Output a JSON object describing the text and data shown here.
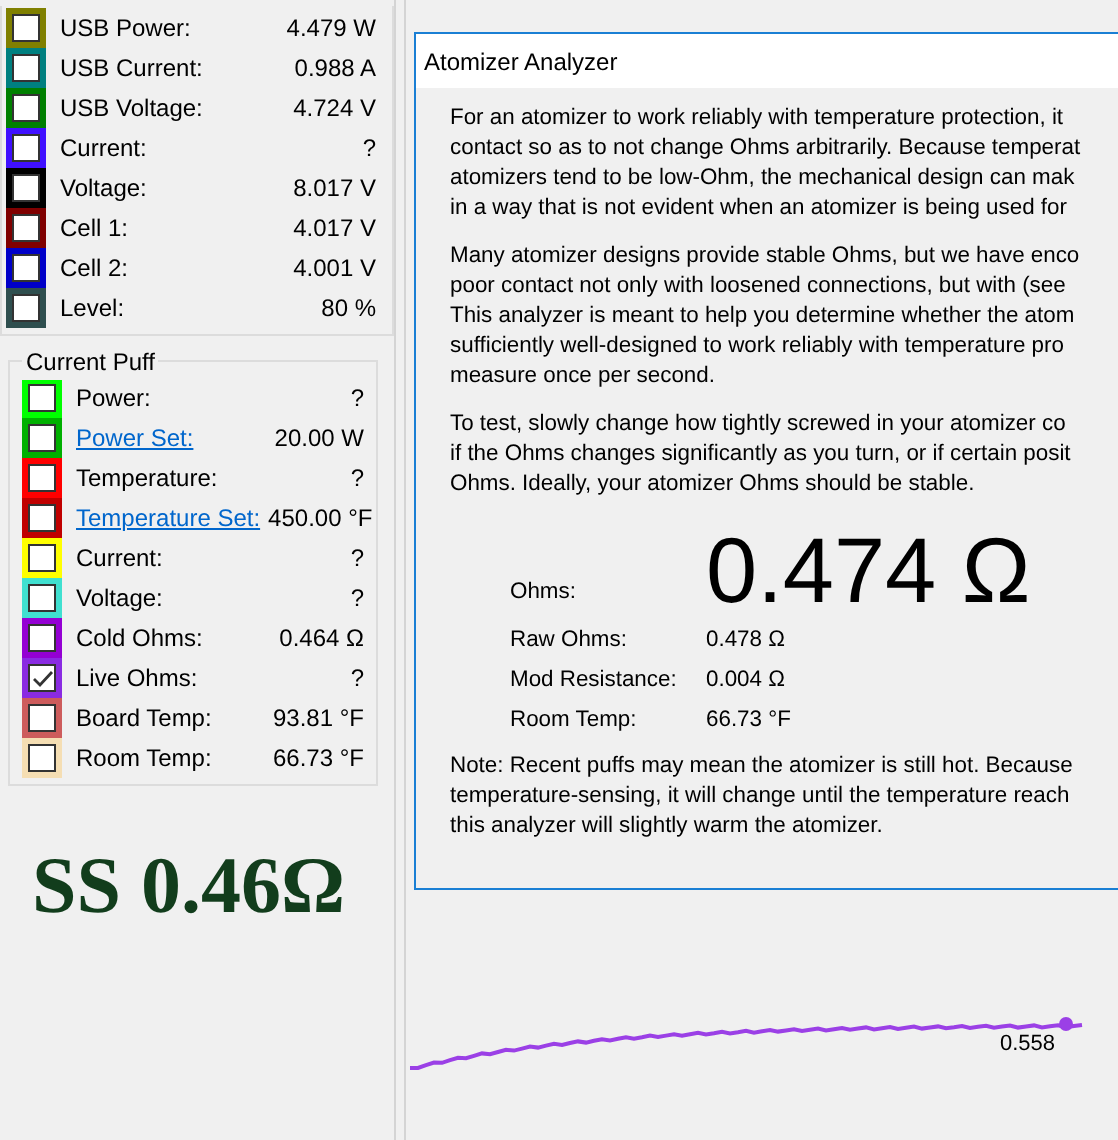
{
  "readings": [
    {
      "label": "USB Power:",
      "value": "4.479 W",
      "color": "#808000",
      "checked": false
    },
    {
      "label": "USB Current:",
      "value": "0.988 A",
      "color": "#008080",
      "checked": false
    },
    {
      "label": "USB Voltage:",
      "value": "4.724 V",
      "color": "#008000",
      "checked": false
    },
    {
      "label": "Current:",
      "value": "?",
      "color": "#4010ff",
      "checked": false
    },
    {
      "label": "Voltage:",
      "value": "8.017 V",
      "color": "#000000",
      "checked": false
    },
    {
      "label": "Cell 1:",
      "value": "4.017 V",
      "color": "#800000",
      "checked": false
    },
    {
      "label": "Cell 2:",
      "value": "4.001 V",
      "color": "#0000c8",
      "checked": false
    },
    {
      "label": "Level:",
      "value": "80 %",
      "color": "#2f4f4f",
      "checked": false
    }
  ],
  "current_puff": {
    "title": "Current Puff",
    "items": [
      {
        "label": "Power:",
        "value": "?",
        "color": "#00ff00",
        "checked": false,
        "kind": "plain"
      },
      {
        "label": "Power Set:",
        "value": "20.00 W",
        "color": "#00b000",
        "checked": false,
        "kind": "link"
      },
      {
        "label": "Temperature:",
        "value": "?",
        "color": "#ff0000",
        "checked": false,
        "kind": "plain"
      },
      {
        "label": "Temperature Set:",
        "value": "450.00 °F",
        "color": "#c00000",
        "checked": false,
        "kind": "link"
      },
      {
        "label": "Current:",
        "value": "?",
        "color": "#ffff00",
        "checked": false,
        "kind": "plain"
      },
      {
        "label": "Voltage:",
        "value": "?",
        "color": "#40e0d0",
        "checked": false,
        "kind": "plain"
      },
      {
        "label": "Cold Ohms:",
        "value": "0.464 Ω",
        "color": "#9400d3",
        "checked": false,
        "kind": "plain"
      },
      {
        "label": "Live Ohms:",
        "value": "?",
        "color": "#8a2be2",
        "checked": true,
        "kind": "plain"
      },
      {
        "label": "Board Temp:",
        "value": "93.81 °F",
        "color": "#cd5c5c",
        "checked": false,
        "kind": "plain"
      },
      {
        "label": "Room Temp:",
        "value": "66.73 °F",
        "color": "#f5deb3",
        "checked": false,
        "kind": "plain"
      }
    ]
  },
  "atomizer_label": "SS 0.46Ω",
  "dialog": {
    "title": "Atomizer Analyzer",
    "paragraphs": [
      [
        "For an atomizer to work reliably with temperature protection, it",
        "contact so as to not change Ohms arbitrarily. Because temperat",
        "atomizers tend to be low-Ohm, the mechanical design can mak",
        "in a way that is not evident when an atomizer is being used for"
      ],
      [
        "Many atomizer designs provide stable Ohms, but we have enco",
        "poor contact not only with loosened connections, but with (see",
        "This analyzer is meant to help you determine whether the atom",
        "sufficiently well-designed to work reliably with temperature pro",
        "measure once per second."
      ],
      [
        "To test, slowly change how tightly screwed in your atomizer co",
        "if the Ohms changes significantly as you turn, or if certain posit",
        "Ohms. Ideally, your atomizer Ohms should be stable."
      ]
    ],
    "ohms_label": "Ohms:",
    "ohms_value": "0.474 Ω",
    "measurements": [
      {
        "label": "Raw Ohms:",
        "value": "0.478 Ω"
      },
      {
        "label": "Mod Resistance:",
        "value": "0.004 Ω"
      },
      {
        "label": "Room Temp:",
        "value": "66.73 °F"
      }
    ],
    "note": [
      "Note: Recent puffs may mean the atomizer is still hot. Because",
      "temperature-sensing, it will change until the temperature reach",
      "this analyzer will slightly warm the atomizer."
    ]
  },
  "graph": {
    "last_value": "0.558"
  }
}
